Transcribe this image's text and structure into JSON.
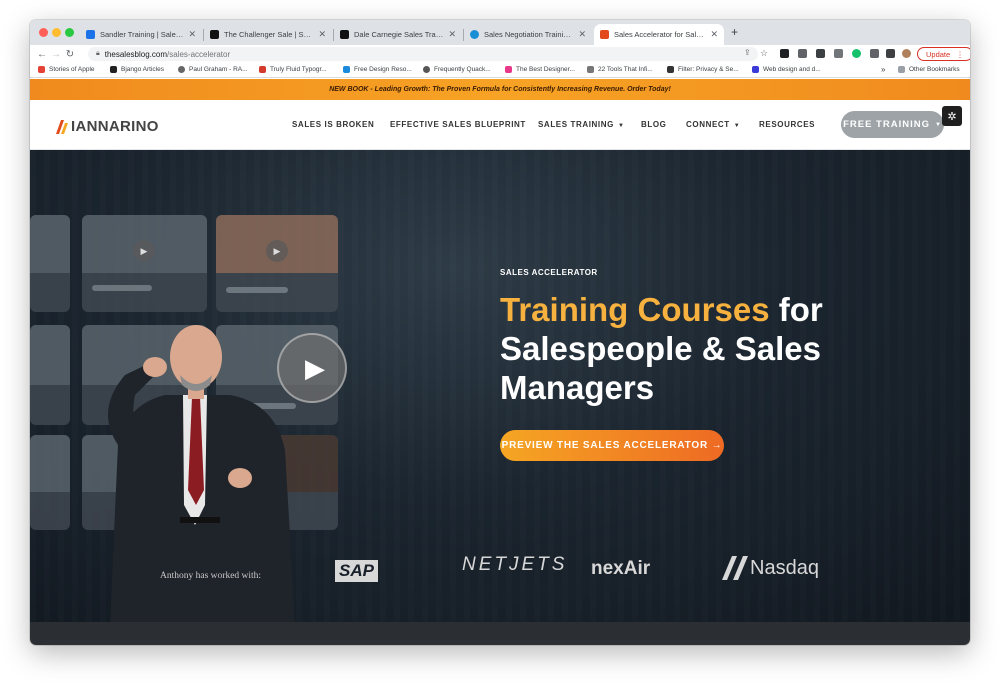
{
  "browser": {
    "tabs": [
      {
        "label": "Sandler Training | Sales Trainin",
        "favicon_color": "#1a73e8"
      },
      {
        "label": "The Challenger Sale | Sales, Ma",
        "favicon_color": "#111111"
      },
      {
        "label": "Dale Carnegie Sales Training: I",
        "favicon_color": "#111111"
      },
      {
        "label": "Sales Negotiation Training Cou",
        "favicon_color": "#1a8fd6"
      },
      {
        "label": "Sales Accelerator for Sales Ma",
        "favicon_color": "#e24a1c"
      }
    ],
    "new_tab": "+",
    "url_host": "thesalesblog.com",
    "url_path": "/sales-accelerator",
    "update_label": "Update",
    "bookmarks": [
      {
        "label": "Stories of Apple",
        "color": "#e34234"
      },
      {
        "label": "Bjango Articles",
        "color": "#222222"
      },
      {
        "label": "Paul Graham - RA...",
        "color": "#666666"
      },
      {
        "label": "Truly Fluid Typogr...",
        "color": "#d33b2c"
      },
      {
        "label": "Free Design Reso...",
        "color": "#1c8adb"
      },
      {
        "label": "Frequently Quack...",
        "color": "#555555"
      },
      {
        "label": "The Best Designer...",
        "color": "#e8388a"
      },
      {
        "label": "22 Tools That Infi...",
        "color": "#777777"
      },
      {
        "label": "Filter: Privacy & Se...",
        "color": "#333333"
      },
      {
        "label": "Web design and d...",
        "color": "#3a3ad6"
      }
    ],
    "bookmarks_more": "»",
    "other_bookmarks": "Other Bookmarks"
  },
  "banner": {
    "text": "NEW BOOK - Leading Growth: The Proven Formula for Consistently Increasing Revenue. Order Today!"
  },
  "header": {
    "logo_text": "IANNARINO",
    "nav": [
      {
        "label": "SALES IS BROKEN",
        "dropdown": false
      },
      {
        "label": "EFFECTIVE SALES BLUEPRINT",
        "dropdown": false
      },
      {
        "label": "SALES TRAINING",
        "dropdown": true
      },
      {
        "label": "BLOG",
        "dropdown": false
      },
      {
        "label": "CONNECT",
        "dropdown": true
      },
      {
        "label": "RESOURCES",
        "dropdown": false
      }
    ],
    "cta_label": "FREE TRAINING",
    "caret": "▼"
  },
  "hero": {
    "eyebrow": "SALES ACCELERATOR",
    "headline_accent": "Training Courses",
    "headline_rest1": " for",
    "headline_line2": "Salespeople & Sales",
    "headline_line3": "Managers",
    "cta_label": "PREVIEW THE SALES ACCELERATOR →",
    "worked_with": "Anthony has worked with:",
    "brands": [
      "SAP",
      "NETJETS",
      "nexAir",
      "Nasdaq"
    ]
  },
  "colors": {
    "accent": "#f6b13e",
    "banner": "#f39a22",
    "cta_start": "#f5a623",
    "cta_end": "#ee6a23"
  }
}
